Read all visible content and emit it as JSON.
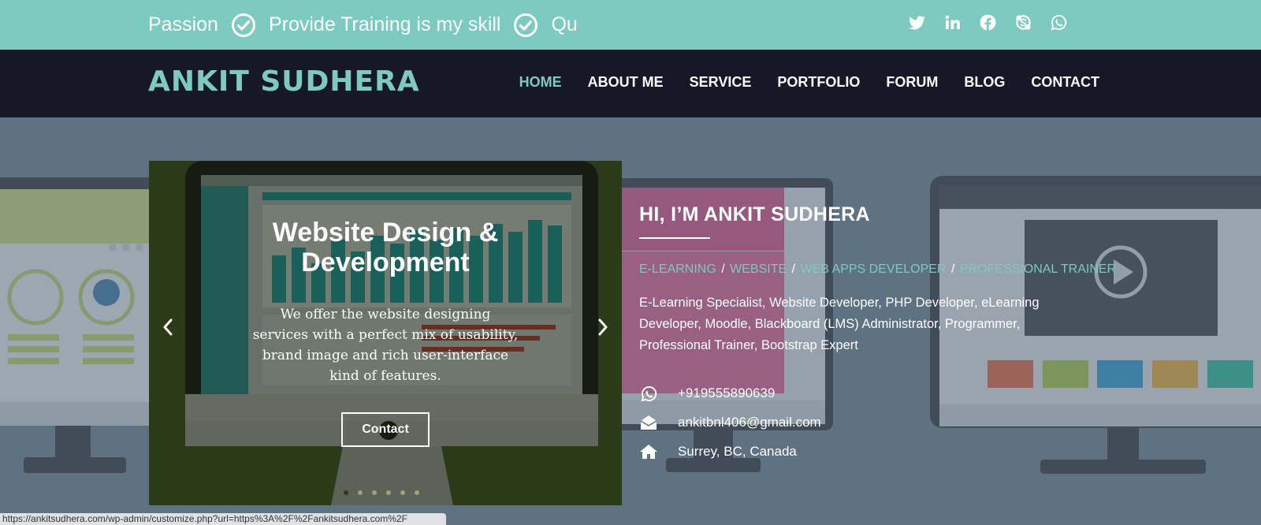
{
  "ticker": [
    {
      "text": "Passion"
    },
    {
      "text": "Provide Training is my skill"
    },
    {
      "text": "Qu"
    }
  ],
  "socials": [
    "twitter-icon",
    "linkedin-icon",
    "facebook-icon",
    "skype-icon",
    "whatsapp-icon"
  ],
  "brand": {
    "name": "ANKIT SUDHERA"
  },
  "nav": {
    "items": [
      {
        "label": "HOME",
        "active": true
      },
      {
        "label": "ABOUT ME"
      },
      {
        "label": "SERVICE"
      },
      {
        "label": "PORTFOLIO"
      },
      {
        "label": "FORUM"
      },
      {
        "label": "BLOG"
      },
      {
        "label": "CONTACT"
      }
    ]
  },
  "slider": {
    "title": "Website Design & Development",
    "description": "We offer the website designing services with a perfect mix of usability, brand image and rich user-interface kind of features.",
    "button": "Contact",
    "dots": 6,
    "active_dot": 0
  },
  "intro": {
    "heading": "HI, I’M ANKIT SUDHERA",
    "roles": [
      "E-LEARNING",
      "WEBSITE",
      "WEB APPS DEVELOPER",
      "PROFESSIONAL TRAINER"
    ],
    "role_separator": "/",
    "description": "E-Learning Specialist, Website Developer, PHP Developer, eLearning Developer, Moodle, Blackboard (LMS) Administrator, Programmer, Professional Trainer, Bootstrap Expert"
  },
  "contacts": {
    "phone": "+919555890639",
    "email": "ankitbnl406@gmail.com",
    "location": "Surrey, BC, Canada"
  },
  "status_url": "https://ankitsudhera.com/wp-admin/customize.php?url=https%3A%2F%2Fankitsudhera.com%2F",
  "colors": {
    "accent": "#7ccac0",
    "nav_bg": "#161827",
    "slider_bg": "#485e2a"
  }
}
